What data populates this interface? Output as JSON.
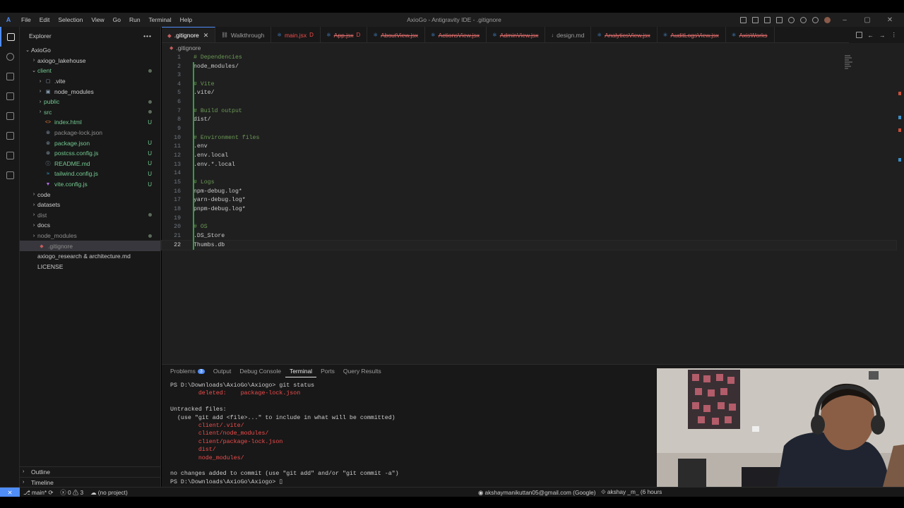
{
  "window": {
    "title": "AxioGo - Antigravity IDE - .gitignore",
    "menu": [
      "File",
      "Edit",
      "Selection",
      "View",
      "Go",
      "Run",
      "Terminal",
      "Help"
    ]
  },
  "sidebar": {
    "header": "Explorer",
    "items": [
      {
        "label": "AxioGo",
        "indent": 0,
        "chev": "⌄",
        "color": "white",
        "icon": ""
      },
      {
        "label": "axiogo_lakehouse",
        "indent": 1,
        "chev": "›",
        "color": "white",
        "icon": ""
      },
      {
        "label": "client",
        "indent": 1,
        "chev": "⌄",
        "color": "green",
        "icon": "",
        "dot": true
      },
      {
        "label": ".vite",
        "indent": 2,
        "chev": "›",
        "color": "white",
        "icon": "▢"
      },
      {
        "label": "node_modules",
        "indent": 2,
        "chev": "›",
        "color": "white",
        "icon": "▣"
      },
      {
        "label": "public",
        "indent": 2,
        "chev": "›",
        "color": "green",
        "icon": "",
        "dot": true
      },
      {
        "label": "src",
        "indent": 2,
        "chev": "›",
        "color": "green",
        "icon": "",
        "dot": true
      },
      {
        "label": "index.html",
        "indent": 2,
        "chev": "",
        "color": "green",
        "icon": "<>",
        "badge": "U"
      },
      {
        "label": "package-lock.json",
        "indent": 2,
        "chev": "",
        "color": "gray",
        "icon": "⊚"
      },
      {
        "label": "package.json",
        "indent": 2,
        "chev": "",
        "color": "green",
        "icon": "⊚",
        "badge": "U"
      },
      {
        "label": "postcss.config.js",
        "indent": 2,
        "chev": "",
        "color": "green",
        "icon": "⊛",
        "badge": "U"
      },
      {
        "label": "README.md",
        "indent": 2,
        "chev": "",
        "color": "green",
        "icon": "ⓘ",
        "badge": "U"
      },
      {
        "label": "tailwind.config.js",
        "indent": 2,
        "chev": "",
        "color": "green",
        "icon": "≈",
        "badge": "U"
      },
      {
        "label": "vite.config.js",
        "indent": 2,
        "chev": "",
        "color": "green",
        "icon": "▼",
        "badge": "U"
      },
      {
        "label": "code",
        "indent": 1,
        "chev": "›",
        "color": "white",
        "icon": ""
      },
      {
        "label": "datasets",
        "indent": 1,
        "chev": "›",
        "color": "white",
        "icon": ""
      },
      {
        "label": "dist",
        "indent": 1,
        "chev": "›",
        "color": "gray",
        "icon": "",
        "dot": true
      },
      {
        "label": "docs",
        "indent": 1,
        "chev": "›",
        "color": "white",
        "icon": ""
      },
      {
        "label": "node_modules",
        "indent": 1,
        "chev": "›",
        "color": "gray",
        "icon": "",
        "dot": true
      },
      {
        "label": ".gitignore",
        "indent": 1,
        "chev": "",
        "color": "gray",
        "icon": "◆",
        "selected": true
      },
      {
        "label": "axiogo_research & architecture.md",
        "indent": 1,
        "chev": "",
        "color": "white",
        "icon": ""
      },
      {
        "label": "LICENSE",
        "indent": 1,
        "chev": "",
        "color": "white",
        "icon": ""
      }
    ],
    "outline": "Outline",
    "timeline": "Timeline"
  },
  "tabs": [
    {
      "label": ".gitignore",
      "icon": "◆",
      "style": "active",
      "close": "✕"
    },
    {
      "label": "Walkthrough",
      "icon": "⛓",
      "style": "normal"
    },
    {
      "label": "main.jsx",
      "icon": "⚛",
      "style": "red",
      "mod": "D"
    },
    {
      "label": "App.jsx",
      "icon": "⚛",
      "style": "redline",
      "mod": "D"
    },
    {
      "label": "AboutView.jsx",
      "icon": "⚛",
      "style": "redline"
    },
    {
      "label": "ActionsView.jsx",
      "icon": "⚛",
      "style": "redline"
    },
    {
      "label": "AdminView.jsx",
      "icon": "⚛",
      "style": "redline"
    },
    {
      "label": "design.md",
      "icon": "↓",
      "style": "normal"
    },
    {
      "label": "AnalyticsView.jsx",
      "icon": "⚛",
      "style": "redline"
    },
    {
      "label": "AuditLogsView.jsx",
      "icon": "⚛",
      "style": "redline"
    },
    {
      "label": "AxisWorks",
      "icon": "⚛",
      "style": "redline"
    }
  ],
  "breadcrumb": ".gitignore",
  "editor": {
    "current_line": 22,
    "lines": [
      {
        "n": "1",
        "text": "# Dependencies",
        "comment": true
      },
      {
        "n": "2",
        "text": "node_modules/",
        "comment": false
      },
      {
        "n": "3",
        "text": "",
        "comment": false
      },
      {
        "n": "4",
        "text": "# Vite",
        "comment": true
      },
      {
        "n": "5",
        "text": ".vite/",
        "comment": false
      },
      {
        "n": "6",
        "text": "",
        "comment": false
      },
      {
        "n": "7",
        "text": "# Build output",
        "comment": true
      },
      {
        "n": "8",
        "text": "dist/",
        "comment": false
      },
      {
        "n": "9",
        "text": "",
        "comment": false
      },
      {
        "n": "10",
        "text": "# Environment files",
        "comment": true
      },
      {
        "n": "11",
        "text": ".env",
        "comment": false
      },
      {
        "n": "12",
        "text": ".env.local",
        "comment": false
      },
      {
        "n": "13",
        "text": ".env.*.local",
        "comment": false
      },
      {
        "n": "14",
        "text": "",
        "comment": false
      },
      {
        "n": "15",
        "text": "# Logs",
        "comment": true
      },
      {
        "n": "16",
        "text": "npm-debug.log*",
        "comment": false
      },
      {
        "n": "17",
        "text": "yarn-debug.log*",
        "comment": false
      },
      {
        "n": "18",
        "text": "pnpm-debug.log*",
        "comment": false
      },
      {
        "n": "19",
        "text": "",
        "comment": false
      },
      {
        "n": "20",
        "text": "# OS",
        "comment": true
      },
      {
        "n": "21",
        "text": ".DS_Store",
        "comment": false
      },
      {
        "n": "22",
        "text": "Thumbs.db",
        "comment": false
      }
    ]
  },
  "panel": {
    "tabs": [
      "Problems",
      "Output",
      "Debug Console",
      "Terminal",
      "Ports",
      "Query Results"
    ],
    "active_tab": "Terminal",
    "problems_count": "3",
    "terminal_lines": [
      {
        "text": "PS D:\\Downloads\\AxioGo\\Axiogo> git status",
        "red": false
      },
      {
        "text": "        deleted:    package-lock.json",
        "red": true
      },
      {
        "text": "",
        "red": false
      },
      {
        "text": "Untracked files:",
        "red": false
      },
      {
        "text": "  (use \"git add <file>...\" to include in what will be committed)",
        "red": false
      },
      {
        "text": "        client/.vite/",
        "red": true
      },
      {
        "text": "        client/node_modules/",
        "red": true
      },
      {
        "text": "        client/package-lock.json",
        "red": true
      },
      {
        "text": "        dist/",
        "red": true
      },
      {
        "text": "        node_modules/",
        "red": true
      },
      {
        "text": "",
        "red": false
      },
      {
        "text": "no changes added to commit (use \"git add\" and/or \"git commit -a\")",
        "red": false
      },
      {
        "text": "PS D:\\Downloads\\AxioGo\\Axiogo> ▯",
        "red": false
      }
    ]
  },
  "status": {
    "branch": "main*",
    "errors": "0",
    "warnings": "3",
    "project": "(no project)",
    "account": "akshaymanikuttan05@gmail.com (Google)",
    "author": "akshay _m_ (6 hours"
  },
  "colors": {
    "accent": "#4f8df7",
    "untracked": "#73c991",
    "deleted": "#f14c4c",
    "comment": "#6a9955"
  }
}
